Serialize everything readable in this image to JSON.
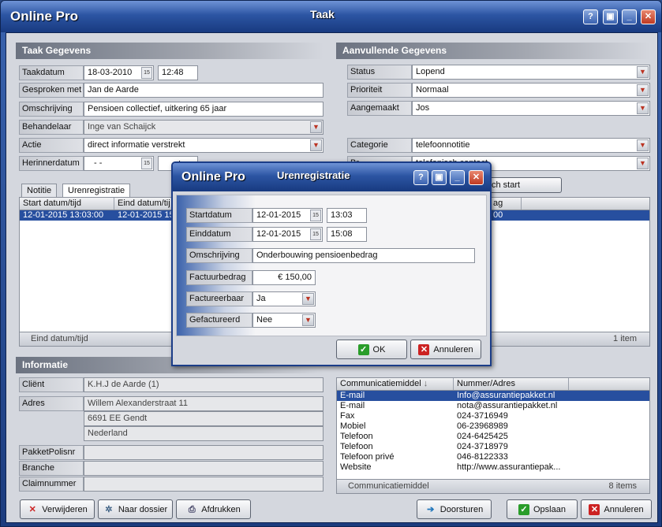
{
  "app": {
    "brand": "Online Pro",
    "title": "Taak"
  },
  "taak": {
    "header": "Taak Gegevens",
    "taakdatum_label": "Taakdatum",
    "taakdatum": "18-03-2010",
    "taaktijd": "12:48",
    "gesproken_label": "Gesproken met",
    "gesproken": "Jan de Aarde",
    "omschrijving_label": "Omschrijving",
    "omschrijving": "Pensioen collectief, uitkering 65 jaar",
    "behandelaar_label": "Behandelaar",
    "behandelaar": "Inge van Schaijck",
    "actie_label": "Actie",
    "actie": "direct informatie verstrekt",
    "herinner_label": "Herinnerdatum",
    "herinner_date": "- -",
    "herinner_time": ":"
  },
  "aanv": {
    "header": "Aanvullende Gegevens",
    "status_label": "Status",
    "status": "Lopend",
    "prioriteit_label": "Prioriteit",
    "prioriteit": "Normaal",
    "aangemaakt_label": "Aangemaakt",
    "aangemaakt": "Jos",
    "categorie_label": "Categorie",
    "categorie": "telefoonnotitie",
    "bron_label": "Br",
    "bron": "telefonisch contact",
    "button_partial": "ch start"
  },
  "tabs": {
    "notitie": "Notitie",
    "uren": "Urenregistratie"
  },
  "uren_grid": {
    "col1": "Start datum/tijd",
    "col2": "Eind datum/tij",
    "col_right": "ag",
    "row_start": "12-01-2015 13:03:00",
    "row_end": "12-01-2015 15:0",
    "row_right": "00",
    "footer_left": "Eind datum/tijd",
    "footer_right": "1 item"
  },
  "info": {
    "header": "Informatie",
    "client_label": "Cliënt",
    "client": "K.H.J de Aarde (1)",
    "adres_label": "Adres",
    "adres1": "Willem Alexanderstraat 11",
    "adres2": "6691 EE Gendt",
    "adres3": "Nederland",
    "pakket_label": "PakketPolisnr",
    "branche_label": "Branche",
    "claim_label": "Claimnummer"
  },
  "comm": {
    "col1": "Communicatiemiddel",
    "col2": "Nummer/Adres",
    "rows": [
      {
        "type": "E-mail",
        "value": "Info@assurantiepakket.nl"
      },
      {
        "type": "E-mail",
        "value": "nota@assurantiepakket.nl"
      },
      {
        "type": "Fax",
        "value": "024-3716949"
      },
      {
        "type": "Mobiel",
        "value": "06-23968989"
      },
      {
        "type": "Telefoon",
        "value": "024-6425425"
      },
      {
        "type": "Telefoon",
        "value": "024-3718979"
      },
      {
        "type": "Telefoon privé",
        "value": "046-8122333"
      },
      {
        "type": "Website",
        "value": "http://www.assurantiepak..."
      }
    ],
    "footer_left": "Communicatiemiddel",
    "footer_right": "8 items"
  },
  "bottom": {
    "verwijderen": "Verwijderen",
    "naar_dossier": "Naar dossier",
    "afdrukken": "Afdrukken",
    "doorsturen": "Doorsturen",
    "opslaan": "Opslaan",
    "annuleren": "Annuleren"
  },
  "dialog": {
    "brand": "Online Pro",
    "title": "Urenregistratie",
    "start_label": "Startdatum",
    "start_date": "12-01-2015",
    "start_time": "13:03",
    "eind_label": "Einddatum",
    "eind_date": "12-01-2015",
    "eind_time": "15:08",
    "omschr_label": "Omschrijving",
    "omschr": "Onderbouwing pensioenbedrag",
    "bedrag_label": "Factuurbedrag",
    "bedrag": "€ 150,00",
    "factureerbaar_label": "Factureerbaar",
    "factureerbaar": "Ja",
    "gefactureerd_label": "Gefactureerd",
    "gefactureerd": "Nee",
    "ok": "OK",
    "annuleren": "Annuleren"
  }
}
